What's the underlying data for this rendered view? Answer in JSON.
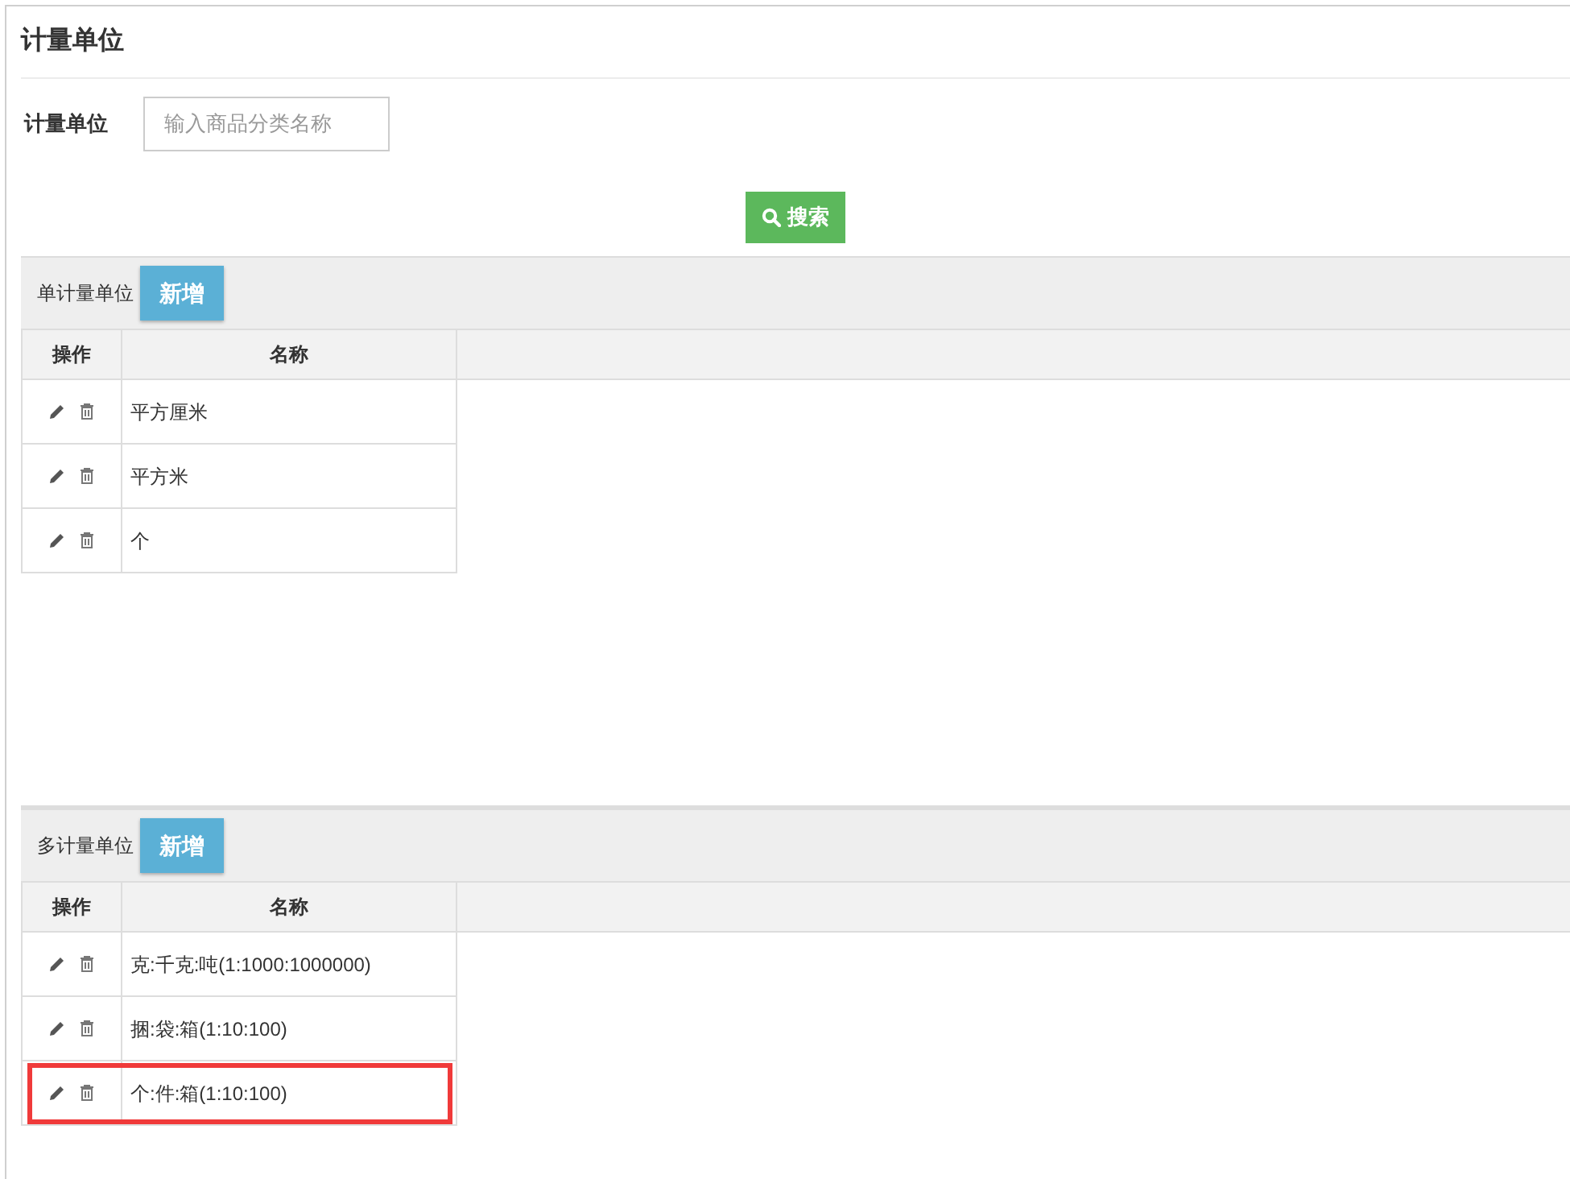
{
  "page_title": "计量单位",
  "filter": {
    "label": "计量单位",
    "placeholder": "输入商品分类名称"
  },
  "search_button": "搜索",
  "sections": [
    {
      "title": "单计量单位",
      "add_button": "新增",
      "columns": [
        "操作",
        "名称"
      ],
      "rows": [
        {
          "name": "平方厘米",
          "highlighted": false
        },
        {
          "name": "平方米",
          "highlighted": false
        },
        {
          "name": "个",
          "highlighted": false
        }
      ]
    },
    {
      "title": "多计量单位",
      "add_button": "新增",
      "columns": [
        "操作",
        "名称"
      ],
      "rows": [
        {
          "name": "克:千克:吨(1:1000:1000000)",
          "highlighted": false
        },
        {
          "name": "捆:袋:箱(1:10:100)",
          "highlighted": false
        },
        {
          "name": "个:件:箱(1:10:100)",
          "highlighted": true
        }
      ]
    }
  ]
}
